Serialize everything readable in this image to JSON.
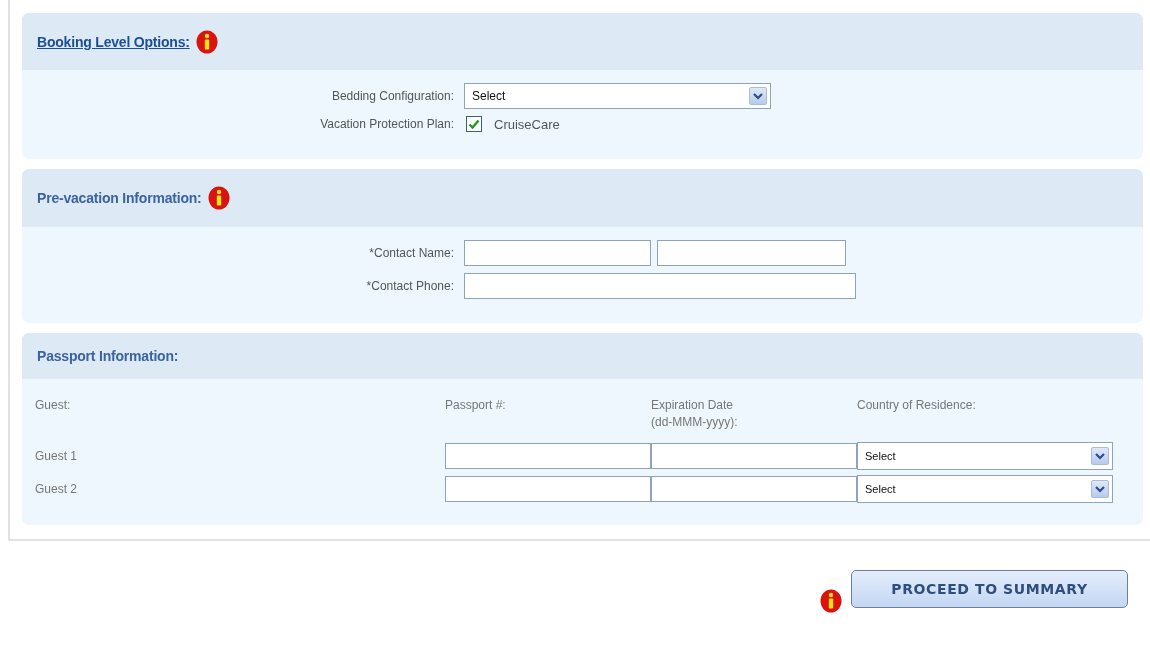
{
  "booking_options": {
    "title": "Booking Level Options:",
    "link": true,
    "info": true,
    "bedding": {
      "label": "Bedding Configuration:",
      "value": "Select"
    },
    "protection": {
      "label": "Vacation Protection Plan:",
      "option": "CruiseCare",
      "checked": true
    }
  },
  "pre_vacation": {
    "title": "Pre-vacation Information:",
    "link": false,
    "info": true,
    "contact_name": {
      "label": "*Contact Name:"
    },
    "contact_phone": {
      "label": "*Contact Phone:"
    }
  },
  "passport": {
    "title": "Passport Information:",
    "link": false,
    "info": false,
    "columns": [
      "Guest:",
      "Passport #:",
      "Expiration Date\n(dd-MMM-yyyy):",
      "Country of Residence:"
    ],
    "rows": [
      {
        "guest": "Guest 1",
        "country": "Select"
      },
      {
        "guest": "Guest 2",
        "country": "Select"
      }
    ]
  },
  "proceed_button": {
    "label": "PROCEED TO SUMMARY",
    "info": true
  }
}
